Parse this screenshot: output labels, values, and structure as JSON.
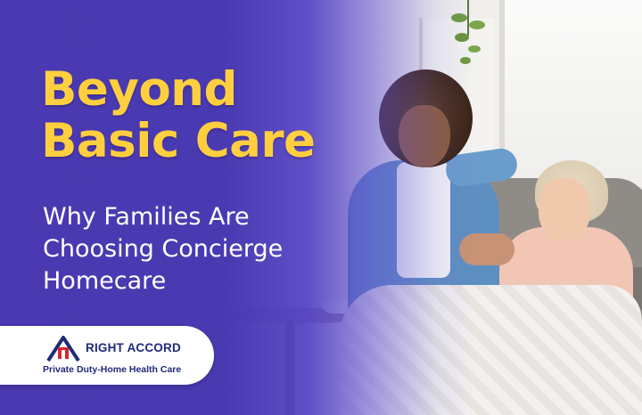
{
  "headline": {
    "line1": "Beyond",
    "line2": "Basic Care"
  },
  "subheadline": {
    "line1": "Why Families Are",
    "line2": "Choosing Concierge",
    "line3": "Homecare"
  },
  "brand": {
    "name": "RIGHT ACCORD",
    "tagline": "Private Duty-Home Health Care",
    "logo_icon": "house-logo-icon"
  },
  "colors": {
    "overlay": "#4a39b0",
    "headline": "#ffcf3f",
    "subheadline": "#ffffff",
    "brand_text": "#1f2a7a",
    "logo_accent": "#d8262e"
  }
}
